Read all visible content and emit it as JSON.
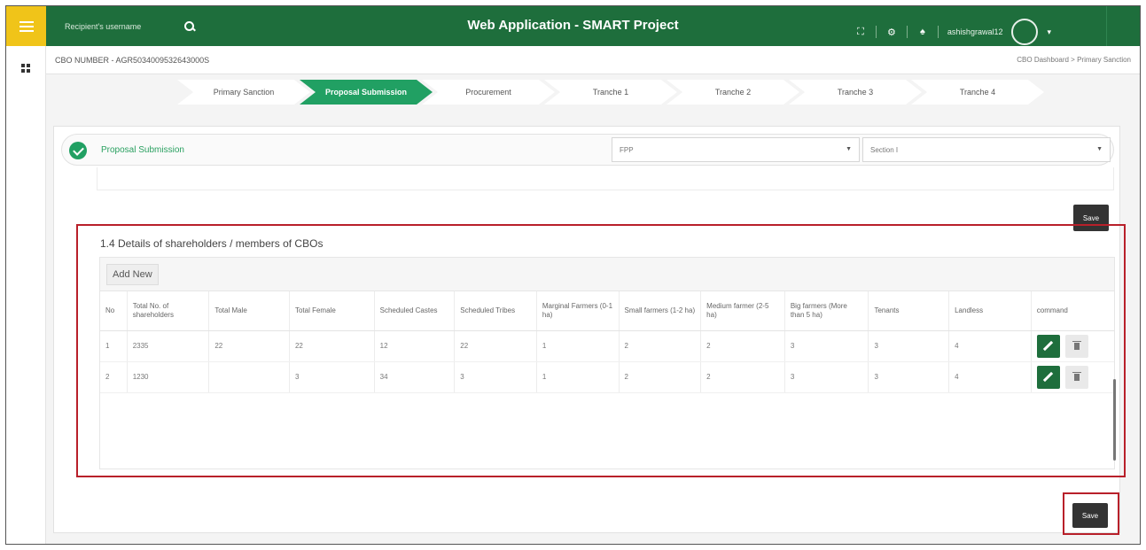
{
  "header": {
    "search_placeholder": "Recipient's username",
    "title": "Web Application - SMART Project",
    "username": "ashishgrawal12"
  },
  "cbo": {
    "number": "CBO NUMBER - AGR5034009532643000S",
    "breadcrumb": "CBO Dashboard  >  Primary Sanction"
  },
  "stepper": [
    {
      "label": "Primary Sanction",
      "active": false
    },
    {
      "label": "Proposal Submission",
      "active": true
    },
    {
      "label": "Procurement",
      "active": false
    },
    {
      "label": "Tranche 1",
      "active": false
    },
    {
      "label": "Tranche 2",
      "active": false
    },
    {
      "label": "Tranche 3",
      "active": false
    },
    {
      "label": "Tranche 4",
      "active": false
    }
  ],
  "section": {
    "title": "Proposal Submission",
    "select1_value": "FPP",
    "select2_value": "Section I",
    "save_label": "Save"
  },
  "details": {
    "title": "1.4 Details of shareholders / members of CBOs",
    "add_new_label": "Add New",
    "columns": [
      "No",
      "Total No. of shareholders",
      "Total Male",
      "Total Female",
      "Scheduled Castes",
      "Scheduled Tribes",
      "Marginal Farmers (0-1 ha)",
      "Small farmers (1-2 ha)",
      "Medium farmer (2-5 ha)",
      "Big farmers (More than 5 ha)",
      "Tenants",
      "Landless",
      "command"
    ],
    "rows": [
      [
        "1",
        "2335",
        "22",
        "22",
        "12",
        "22",
        "1",
        "2",
        "2",
        "3",
        "3",
        "4"
      ],
      [
        "2",
        "1230",
        "",
        "3",
        "34",
        "3",
        "1",
        "2",
        "2",
        "3",
        "3",
        "4"
      ]
    ]
  },
  "footer": {
    "save_label": "Save"
  },
  "colors": {
    "primary_green": "#1e6e3c",
    "accent_green": "#21a063",
    "menu_yellow": "#f0c419",
    "highlight_red": "#b8202a"
  }
}
